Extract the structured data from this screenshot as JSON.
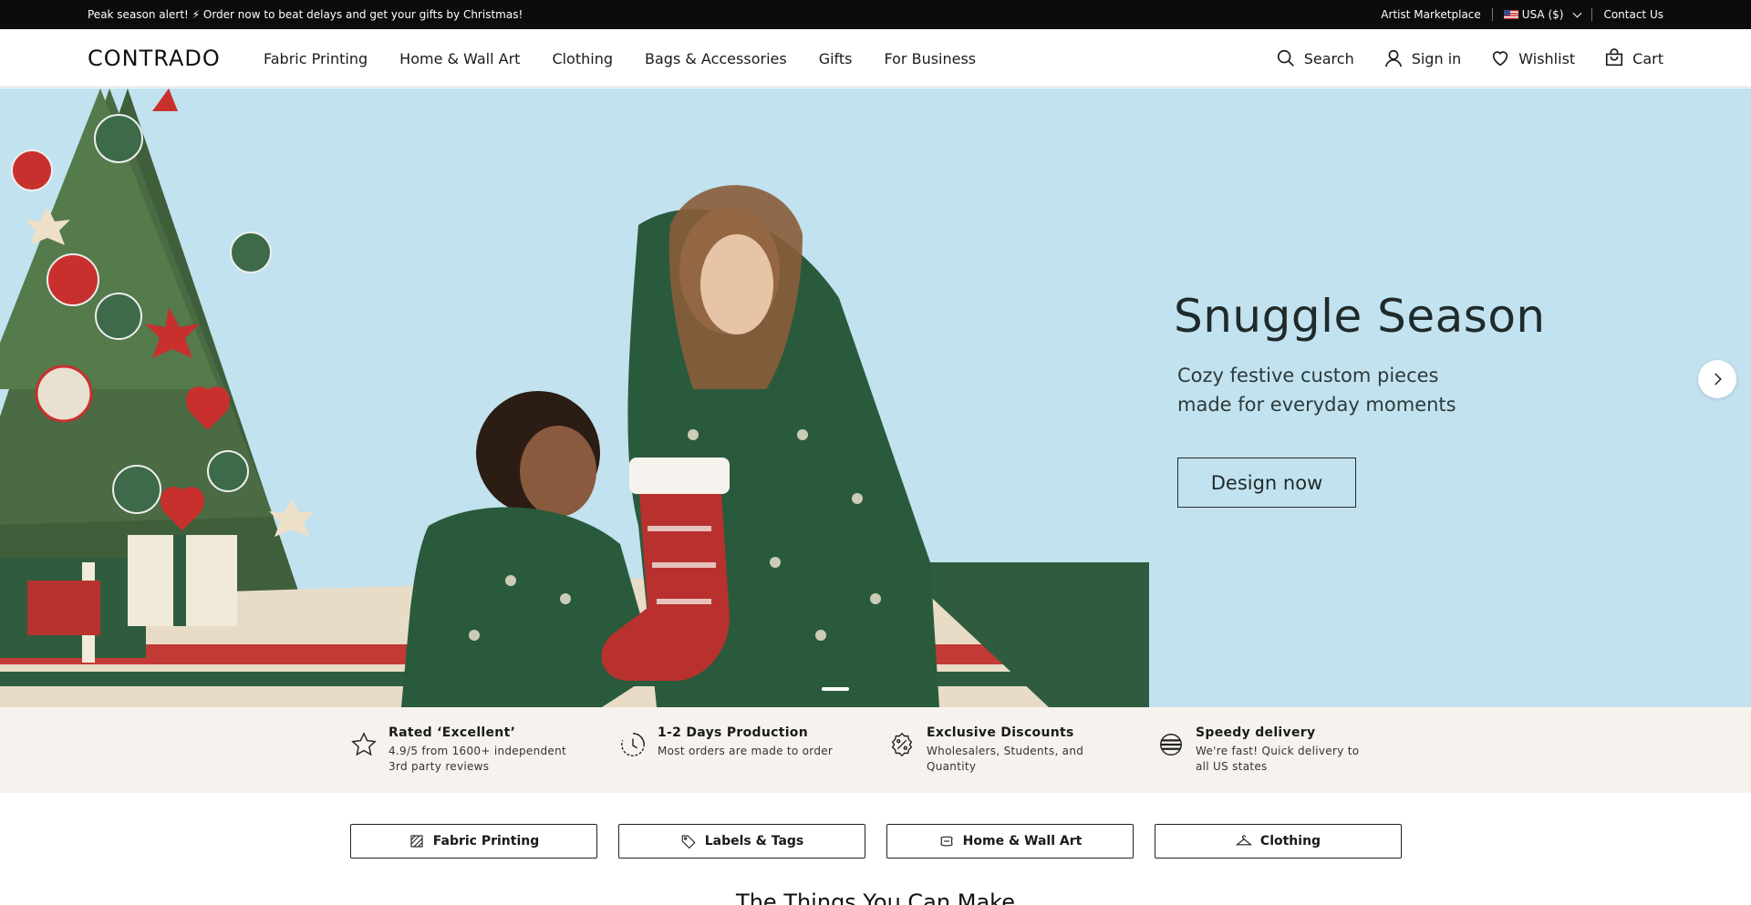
{
  "topbar": {
    "announcement": "Peak season alert! ⚡ Order now to beat delays and get your gifts by Christmas!",
    "artist_marketplace": "Artist Marketplace",
    "country": "USA ($)",
    "contact": "Contact Us"
  },
  "header": {
    "logo": "CONTRADO",
    "nav": [
      "Fabric Printing",
      "Home & Wall Art",
      "Clothing",
      "Bags & Accessories",
      "Gifts",
      "For Business"
    ],
    "search": "Search",
    "sign_in": "Sign in",
    "wishlist": "Wishlist",
    "cart": "Cart"
  },
  "hero": {
    "title": "Snuggle Season",
    "subtitle": "Cozy festive custom pieces made for everyday moments",
    "cta": "Design now",
    "slide_count": 1
  },
  "trust": [
    {
      "title": "Rated ‘Excellent’",
      "text": "4.9/5 from 1600+ independent 3rd party reviews",
      "icon": "star-icon"
    },
    {
      "title": "1-2 Days Production",
      "text": "Most orders are made to order",
      "icon": "clock-icon"
    },
    {
      "title": "Exclusive Discounts",
      "text": "Wholesalers, Students, and Quantity",
      "icon": "discount-badge-icon"
    },
    {
      "title": "Speedy delivery",
      "text": "We're fast! Quick delivery to all US states",
      "icon": "speed-globe-icon"
    }
  ],
  "pills": [
    {
      "label": "Fabric Printing",
      "icon": "fabric-swatch-icon"
    },
    {
      "label": "Labels & Tags",
      "icon": "tag-icon"
    },
    {
      "label": "Home & Wall Art",
      "icon": "cushion-icon"
    },
    {
      "label": "Clothing",
      "icon": "hanger-icon"
    }
  ],
  "section_title": "The Things You Can Make",
  "colors": {
    "topbar_bg": "#0c0c0c",
    "hero_bg": "#c2e2ef",
    "trust_bg": "#f6f3ee",
    "sweater_green": "#2a5a3c",
    "stocking_red": "#b8312f"
  }
}
